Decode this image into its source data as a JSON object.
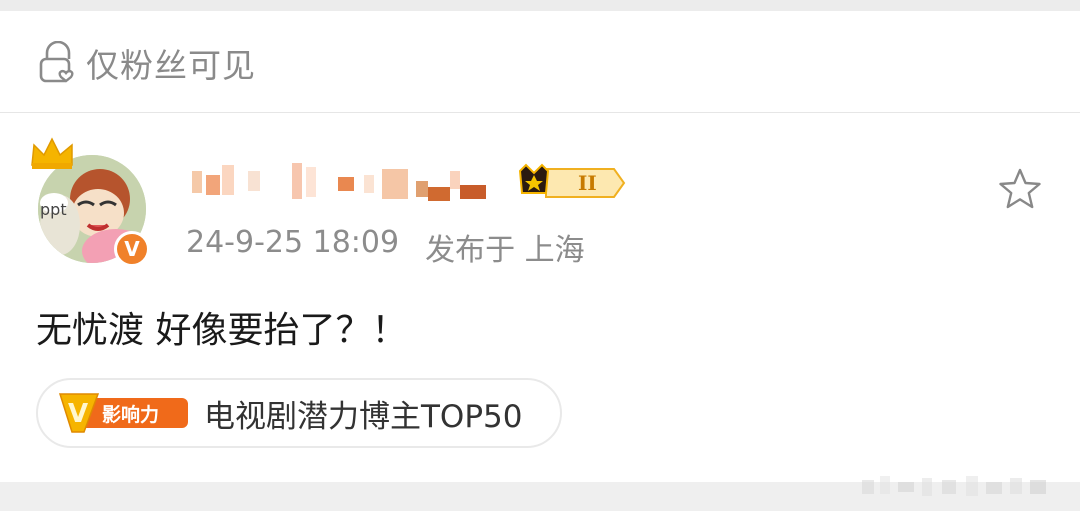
{
  "visibility": {
    "label": "仅粉丝可见",
    "icon": "lock-heart-icon"
  },
  "post": {
    "author_level": "II",
    "timestamp": "24-9-25 18:09",
    "published_location": "发布于 上海",
    "content": "无忧渡 好像要抬了？！",
    "verified_mark": "V",
    "influence": {
      "badge_text": "影响力",
      "badge_v": "V",
      "label": "电视剧潜力博主TOP50"
    }
  },
  "colors": {
    "accent_orange": "#f0812a",
    "gold": "#f5b400",
    "muted_text": "#8c8c8c"
  }
}
